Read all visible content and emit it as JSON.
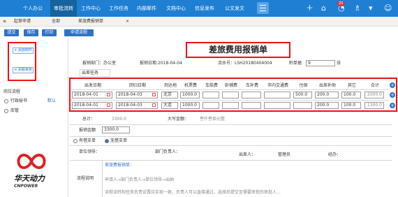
{
  "nav": {
    "items": [
      "个人办公",
      "审批流转",
      "工作中心",
      "工作任务",
      "内部邮件",
      "文档中心",
      "信息发布",
      "公文发文"
    ],
    "active_index": 1,
    "notification_count": "20"
  },
  "tabs": {
    "home": "起草申请",
    "all": "全部",
    "current": "差旅费报销单"
  },
  "toolbar": {
    "submit": "提交",
    "save": "保存",
    "print": "打印",
    "flow": "申请流程"
  },
  "sidebar": {
    "add_attachment": "+ 添加附件",
    "link_doc": "+ 关联事务",
    "flow_label": "岗位流程",
    "flow_option_label": "行政秘书",
    "flow_option_default": "默认",
    "other_label": "库管"
  },
  "logo": {
    "name": "华天动力",
    "english": "CNPOWER"
  },
  "form": {
    "title": "差旅费用报销单",
    "dept_label": "报销部门：办公室",
    "date_label": "报销日期:2018-04-04",
    "serial_label": "流水号：LSH20180404004",
    "attach_label": "附单据",
    "attach_value": "9",
    "attach_unit": "张",
    "trip_task_label": "出差任务",
    "columns": [
      "出发日期",
      "回归日期",
      "到达地",
      "机票费",
      "车船费",
      "卧铺费",
      "车补费",
      "市内交通费",
      "住宿",
      "出差补助",
      "其它",
      "合计"
    ],
    "rows": [
      [
        "2018-04-01",
        "2018-04-03",
        "北京",
        "1000.0",
        "",
        "",
        "",
        "",
        "500.0",
        "200.0",
        "100.0",
        "2000.0"
      ],
      [
        "2018-04-01",
        "2018-04-03",
        "大连",
        "1000.0",
        "",
        "",
        "",
        "",
        "",
        "200.0",
        "100.0",
        "1300.0"
      ]
    ],
    "total_label": "总计：",
    "total_value": "3300.0",
    "total_upper_label": "大写金额：",
    "total_upper_value": "叁仟叁佰元整",
    "amount_label": "报销金额",
    "amount_value": "3300.0",
    "radio_borrow": "有借支单",
    "radio_noborrow": "无借支单",
    "leader_label": "单位领导：",
    "dept_head_label": "部门负责人：",
    "applicant_label": "出差人：",
    "applicant_value": "管理员",
    "handler_label": "经办：",
    "flow_desc_label": "流程说明",
    "flow_title": "差旅费报销单：",
    "flow_line1": "申请人→部门负责人→单位领导→出纳",
    "flow_line2": "流程流转和任务负责设置应实现一致，负责人可以直接通过，选择后提交至需要审批的审批人…"
  }
}
